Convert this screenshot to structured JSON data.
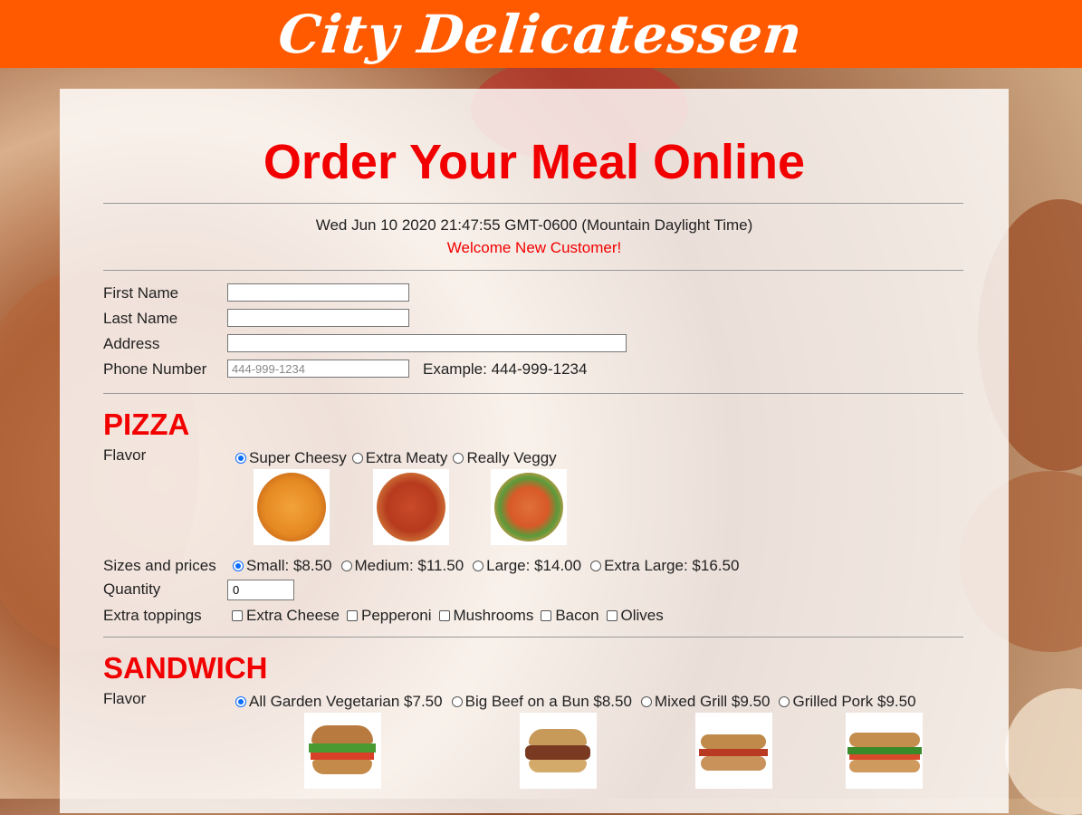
{
  "header": {
    "title": "City Delicatessen"
  },
  "page": {
    "heading": "Order Your Meal Online",
    "datetime": "Wed Jun 10 2020 21:47:55 GMT-0600 (Mountain Daylight Time)",
    "welcome": "Welcome New Customer!"
  },
  "customer": {
    "first_name_label": "First Name",
    "last_name_label": "Last Name",
    "address_label": "Address",
    "phone_label": "Phone Number",
    "phone_placeholder": "444-999-1234",
    "phone_example": "Example: 444-999-1234",
    "first_name_value": "",
    "last_name_value": "",
    "address_value": "",
    "phone_value": ""
  },
  "pizza": {
    "heading": "PIZZA",
    "flavor_label": "Flavor",
    "flavors": [
      {
        "label": "Super Cheesy",
        "selected": true
      },
      {
        "label": "Extra Meaty",
        "selected": false
      },
      {
        "label": "Really Veggy",
        "selected": false
      }
    ],
    "sizes_label": "Sizes and prices",
    "sizes": [
      {
        "label": "Small: $8.50",
        "selected": true
      },
      {
        "label": "Medium: $11.50",
        "selected": false
      },
      {
        "label": "Large: $14.00",
        "selected": false
      },
      {
        "label": "Extra Large: $16.50",
        "selected": false
      }
    ],
    "quantity_label": "Quantity",
    "quantity_value": "0",
    "toppings_label": "Extra toppings",
    "toppings": [
      {
        "label": "Extra Cheese",
        "checked": false
      },
      {
        "label": "Pepperoni",
        "checked": false
      },
      {
        "label": "Mushrooms",
        "checked": false
      },
      {
        "label": "Bacon",
        "checked": false
      },
      {
        "label": "Olives",
        "checked": false
      }
    ]
  },
  "sandwich": {
    "heading": "SANDWICH",
    "flavor_label": "Flavor",
    "flavors": [
      {
        "label": "All Garden Vegetarian $7.50",
        "selected": true
      },
      {
        "label": "Big Beef on a Bun $8.50",
        "selected": false
      },
      {
        "label": "Mixed Grill $9.50",
        "selected": false
      },
      {
        "label": "Grilled Pork $9.50",
        "selected": false
      }
    ]
  },
  "colors": {
    "banner": "#ff5a00",
    "accent_red": "#f20000",
    "radio_blue": "#0a6cff"
  }
}
